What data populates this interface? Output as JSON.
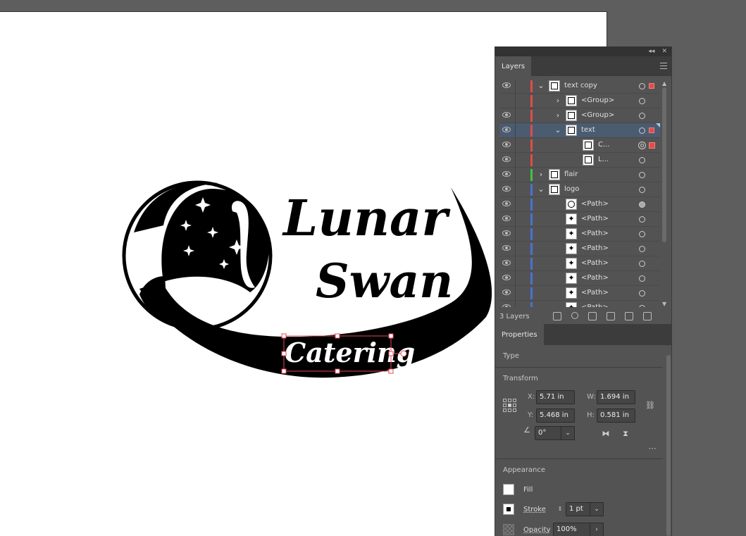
{
  "canvas": {
    "logo_line1": "Lunar",
    "logo_line2": "Swan",
    "logo_tagline": "Catering"
  },
  "panel": {
    "collapse_icon": "double-chevron-left-icon",
    "close_icon": "close-icon",
    "layers_tab": "Layers",
    "properties_tab": "Properties",
    "layers": [
      {
        "name": "text copy",
        "indent": 0,
        "chevron": "down",
        "visible": true,
        "color": "#e14c4c"
      },
      {
        "name": "<Group>",
        "indent": 1,
        "chevron": "right",
        "visible": false,
        "color": "#e14c4c"
      },
      {
        "name": "<Group>",
        "indent": 1,
        "chevron": "right",
        "visible": true,
        "color": "#e14c4c"
      },
      {
        "name": "text",
        "indent": 1,
        "chevron": "down",
        "visible": true,
        "color": "#e14c4c"
      },
      {
        "name": "C...",
        "indent": 2,
        "chevron": "",
        "visible": true,
        "color": "#e14c4c"
      },
      {
        "name": "L...",
        "indent": 2,
        "chevron": "",
        "visible": true,
        "color": "#e14c4c"
      },
      {
        "name": "flair",
        "indent": 0,
        "chevron": "right",
        "visible": true,
        "color": "#3fc43f"
      },
      {
        "name": "logo",
        "indent": 0,
        "chevron": "down",
        "visible": true,
        "color": "#4b6fd6"
      },
      {
        "name": "<Path>",
        "indent": 1,
        "chevron": "",
        "visible": true,
        "color": "#4b6fd6"
      },
      {
        "name": "<Path>",
        "indent": 1,
        "chevron": "",
        "visible": true,
        "color": "#4b6fd6"
      },
      {
        "name": "<Path>",
        "indent": 1,
        "chevron": "",
        "visible": true,
        "color": "#4b6fd6"
      },
      {
        "name": "<Path>",
        "indent": 1,
        "chevron": "",
        "visible": true,
        "color": "#4b6fd6"
      },
      {
        "name": "<Path>",
        "indent": 1,
        "chevron": "",
        "visible": true,
        "color": "#4b6fd6"
      },
      {
        "name": "<Path>",
        "indent": 1,
        "chevron": "",
        "visible": true,
        "color": "#4b6fd6"
      },
      {
        "name": "<Path>",
        "indent": 1,
        "chevron": "",
        "visible": true,
        "color": "#4b6fd6"
      },
      {
        "name": "<Path>",
        "indent": 1,
        "chevron": "",
        "visible": true,
        "color": "#4b6fd6"
      }
    ],
    "layers_count": "3 Layers",
    "properties": {
      "type_label": "Type",
      "transform_label": "Transform",
      "x_label": "X:",
      "x_value": "5.71 in",
      "y_label": "Y:",
      "y_value": "5.468 in",
      "w_label": "W:",
      "w_value": "1.694 in",
      "h_label": "H:",
      "h_value": "0.581 in",
      "angle_value": "0°",
      "appearance_label": "Appearance",
      "fill_label": "Fill",
      "stroke_label": "Stroke",
      "stroke_value": "1 pt",
      "opacity_label": "Opacity",
      "opacity_value": "100%"
    }
  }
}
